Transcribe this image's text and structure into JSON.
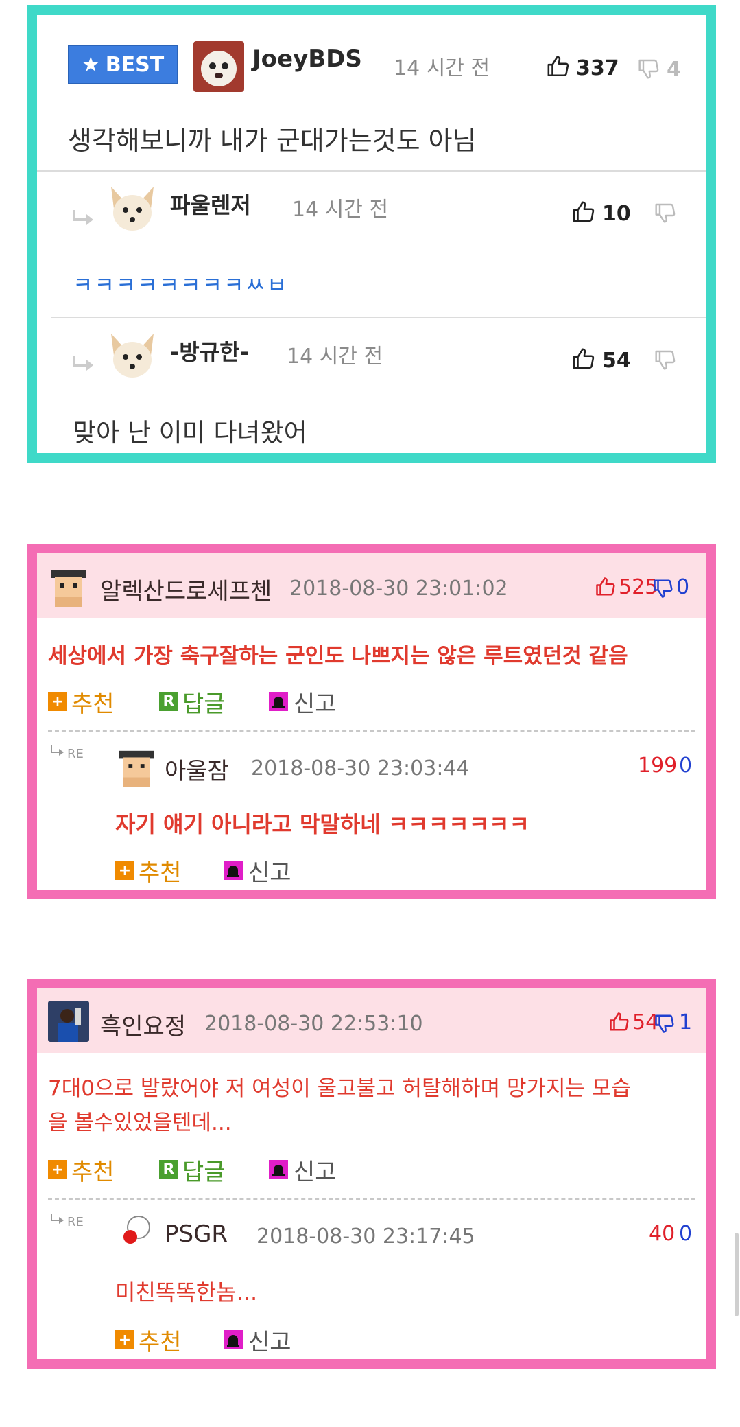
{
  "best_comment": {
    "badge": "BEST",
    "user": "JoeyBDS",
    "time": "14 시간 전",
    "likes": "337",
    "dislikes": "4",
    "text": "생각해보니까 내가 군대가는것도 아님",
    "replies": [
      {
        "user": "파울렌저",
        "time": "14 시간 전",
        "likes": "10",
        "text": "ㅋㅋㅋㅋㅋㅋㅋㅋㅆㅂ"
      },
      {
        "user": "-방규한-",
        "time": "14 시간 전",
        "likes": "54",
        "text": "맞아 난 이미 다녀왔어"
      }
    ]
  },
  "comments": [
    {
      "user": "알렉산드로세프첸",
      "date": "2018-08-30 23:01:02",
      "up": "525",
      "down": "0",
      "text": "세상에서 가장 축구잘하는 군인도 나쁘지는 않은 루트였던것 같음",
      "actions": {
        "recommend": "추천",
        "reply": "답글",
        "report": "신고"
      },
      "reply": {
        "re_label": "RE",
        "user": "아울잠",
        "date": "2018-08-30 23:03:44",
        "up": "199",
        "down": "0",
        "text": "자기 얘기 아니라고 막말하네 ㅋㅋㅋㅋㅋㅋㅋ",
        "actions": {
          "recommend": "추천",
          "report": "신고"
        }
      }
    },
    {
      "user": "흑인요정",
      "date": "2018-08-30 22:53:10",
      "up": "54",
      "down": "1",
      "text_line1": "7대0으로 발랐어야 저 여성이 울고불고 허탈해하며 망가지는 모습",
      "text_line2": "을 볼수있었을텐데...",
      "actions": {
        "recommend": "추천",
        "reply": "답글",
        "report": "신고"
      },
      "reply": {
        "re_label": "RE",
        "user": "PSGR",
        "date": "2018-08-30 23:17:45",
        "up": "40",
        "down": "0",
        "text": "미친똑똑한놈...",
        "actions": {
          "recommend": "추천",
          "report": "신고"
        }
      }
    }
  ],
  "colors": {
    "teal_frame": "#3fd9c8",
    "pink_frame": "#f46db4",
    "best_badge": "#3c7ddf",
    "pink_header": "#fde0e6",
    "red_text": "#e03a2e",
    "up_red": "#e0202a",
    "down_blue": "#2040d0"
  },
  "icons": [
    "star-icon",
    "thumb-up-icon",
    "thumb-down-icon",
    "reply-arrow-icon",
    "plus-icon",
    "r-icon",
    "siren-icon"
  ]
}
